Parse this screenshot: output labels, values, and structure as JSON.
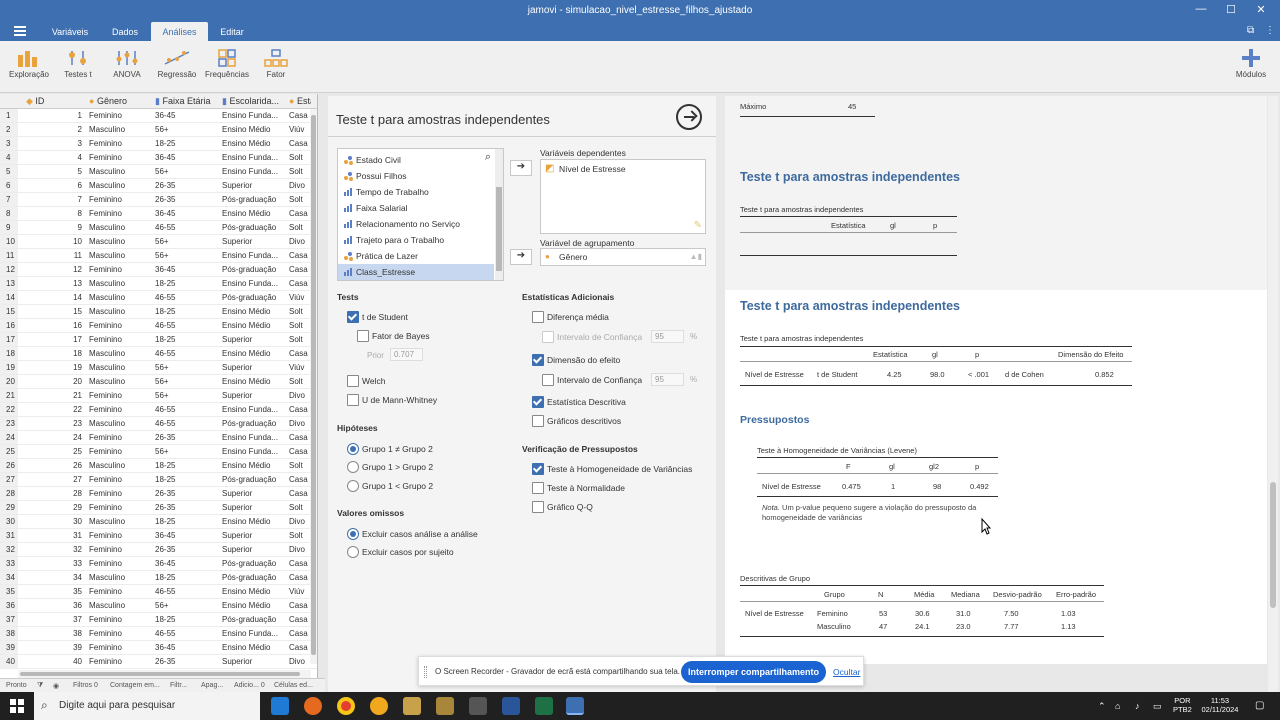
{
  "window": {
    "title": "jamovi - simulacao_nivel_estresse_filhos_ajustado",
    "minimize": "—",
    "maximize": "☐",
    "close": "✕"
  },
  "menu": {
    "tabs": [
      "Variáveis",
      "Dados",
      "Análises",
      "Editar"
    ],
    "active": "Análises"
  },
  "ribbon": {
    "items": [
      "Exploração",
      "Testes t",
      "ANOVA",
      "Regressão",
      "Frequências",
      "Fator"
    ],
    "modules": "Módulos"
  },
  "sheet": {
    "headers": [
      "ID",
      "Gênero",
      "Faixa Etária",
      "Escolarida...",
      "Esta"
    ],
    "rows": [
      [
        "1",
        "Feminino",
        "36-45",
        "Ensino Funda...",
        "Casa"
      ],
      [
        "2",
        "Masculino",
        "56+",
        "Ensino Médio",
        "Viúv"
      ],
      [
        "3",
        "Feminino",
        "18-25",
        "Ensino Médio",
        "Casa"
      ],
      [
        "4",
        "Feminino",
        "36-45",
        "Ensino Funda...",
        "Solt"
      ],
      [
        "5",
        "Masculino",
        "56+",
        "Ensino Funda...",
        "Solt"
      ],
      [
        "6",
        "Masculino",
        "26-35",
        "Superior",
        "Divo"
      ],
      [
        "7",
        "Feminino",
        "26-35",
        "Pós-graduação",
        "Solt"
      ],
      [
        "8",
        "Feminino",
        "36-45",
        "Ensino Médio",
        "Casa"
      ],
      [
        "9",
        "Masculino",
        "46-55",
        "Pós-graduação",
        "Solt"
      ],
      [
        "10",
        "Masculino",
        "56+",
        "Superior",
        "Divo"
      ],
      [
        "11",
        "Masculino",
        "56+",
        "Ensino Funda...",
        "Casa"
      ],
      [
        "12",
        "Feminino",
        "36-45",
        "Pós-graduação",
        "Casa"
      ],
      [
        "13",
        "Masculino",
        "18-25",
        "Ensino Funda...",
        "Casa"
      ],
      [
        "14",
        "Masculino",
        "46-55",
        "Pós-graduação",
        "Viúv"
      ],
      [
        "15",
        "Masculino",
        "18-25",
        "Ensino Médio",
        "Solt"
      ],
      [
        "16",
        "Feminino",
        "46-55",
        "Ensino Médio",
        "Solt"
      ],
      [
        "17",
        "Feminino",
        "18-25",
        "Superior",
        "Solt"
      ],
      [
        "18",
        "Masculino",
        "46-55",
        "Ensino Médio",
        "Casa"
      ],
      [
        "19",
        "Masculino",
        "56+",
        "Superior",
        "Viúv"
      ],
      [
        "20",
        "Masculino",
        "56+",
        "Ensino Médio",
        "Solt"
      ],
      [
        "21",
        "Feminino",
        "56+",
        "Superior",
        "Divo"
      ],
      [
        "22",
        "Feminino",
        "46-55",
        "Ensino Funda...",
        "Casa"
      ],
      [
        "23",
        "Masculino",
        "46-55",
        "Pós-graduação",
        "Divo"
      ],
      [
        "24",
        "Feminino",
        "26-35",
        "Ensino Funda...",
        "Casa"
      ],
      [
        "25",
        "Feminino",
        "56+",
        "Ensino Funda...",
        "Casa"
      ],
      [
        "26",
        "Masculino",
        "18-25",
        "Ensino Médio",
        "Solt"
      ],
      [
        "27",
        "Feminino",
        "18-25",
        "Pós-graduação",
        "Casa"
      ],
      [
        "28",
        "Feminino",
        "26-35",
        "Superior",
        "Casa"
      ],
      [
        "29",
        "Feminino",
        "26-35",
        "Superior",
        "Solt"
      ],
      [
        "30",
        "Masculino",
        "18-25",
        "Ensino Médio",
        "Divo"
      ],
      [
        "31",
        "Feminino",
        "36-45",
        "Superior",
        "Solt"
      ],
      [
        "32",
        "Feminino",
        "26-35",
        "Superior",
        "Divo"
      ],
      [
        "33",
        "Feminino",
        "36-45",
        "Pós-graduação",
        "Casa"
      ],
      [
        "34",
        "Masculino",
        "18-25",
        "Pós-graduação",
        "Casa"
      ],
      [
        "35",
        "Feminino",
        "46-55",
        "Ensino Médio",
        "Viúv"
      ],
      [
        "36",
        "Masculino",
        "56+",
        "Ensino Médio",
        "Casa"
      ],
      [
        "37",
        "Feminino",
        "18-25",
        "Pós-graduação",
        "Casa"
      ],
      [
        "38",
        "Feminino",
        "46-55",
        "Ensino Funda...",
        "Casa"
      ],
      [
        "39",
        "Feminino",
        "36-45",
        "Ensino Médio",
        "Casa"
      ],
      [
        "40",
        "Feminino",
        "26-35",
        "Superior",
        "Divo"
      ]
    ]
  },
  "status": {
    "ready": "Pronto",
    "filters": "Filtros 0",
    "count": "Contagem em...",
    "filt": "Filtr...",
    "apag": "Apag...",
    "adic": "Adicio... 0",
    "cells": "Células ed..."
  },
  "options": {
    "title": "Teste t para amostras independentes",
    "variables": [
      {
        "name": "Estado Civil",
        "type": "nominal"
      },
      {
        "name": "Possui Filhos",
        "type": "nominal"
      },
      {
        "name": "Tempo de Trabalho",
        "type": "ordinal"
      },
      {
        "name": "Faixa Salarial",
        "type": "ordinal"
      },
      {
        "name": "Relacionamento no Serviço",
        "type": "ordinal"
      },
      {
        "name": "Trajeto para o Trabalho",
        "type": "ordinal"
      },
      {
        "name": "Prática de Lazer",
        "type": "nominal"
      },
      {
        "name": "Class_Estresse",
        "type": "ordinal"
      }
    ],
    "arrow": "➔",
    "dependent_label": "Variáveis dependentes",
    "dependent_value": "Nível de Estresse",
    "group_label": "Variável de agrupamento",
    "group_value": "Gênero",
    "tests_label": "Tests",
    "student": "t de Student",
    "bayes": "Fator de Bayes",
    "prior_label": "Prior",
    "prior_value": "0.707",
    "welch": "Welch",
    "mann": "U de Mann-Whitney",
    "hyp_label": "Hipóteses",
    "hyp1": "Grupo 1 ≠ Grupo 2",
    "hyp2": "Grupo 1 > Grupo 2",
    "hyp3": "Grupo 1 < Grupo 2",
    "missing_label": "Valores omissos",
    "missing1": "Excluir casos análise a análise",
    "missing2": "Excluir casos por sujeito",
    "add_label": "Estatísticas Adicionais",
    "mean_diff": "Diferença média",
    "ci": "Intervalo de Confiança",
    "ci_value": "95",
    "pct": "%",
    "effect": "Dimensão do efeito",
    "desc": "Estatística Descritiva",
    "desc_plots": "Gráficos descritivos",
    "assump_label": "Verificação de Pressupostos",
    "homog": "Teste à Homogeneidade de Variâncias",
    "normal": "Teste à Normalidade",
    "qq": "Gráfico Q-Q"
  },
  "results": {
    "prev_label": "Máximo",
    "prev_value": "45",
    "h1_prev": "Teste t para amostras independentes",
    "cap_prev": "Teste t para amostras independentes",
    "prev_cols": [
      "Estatística",
      "gl",
      "p"
    ],
    "h1": "Teste t para amostras independentes",
    "cap": "Teste t para amostras independentes",
    "ttest_cols": [
      "Estatística",
      "gl",
      "p",
      "Dimensão do Efeito"
    ],
    "ttest_row": [
      "Nível de Estresse",
      "t de Student",
      "4.25",
      "98.0",
      "< .001",
      "d de Cohen",
      "0.852"
    ],
    "h2": "Pressupostos",
    "lev_cap": "Teste à Homogeneidade de Variâncias (Levene)",
    "lev_cols": [
      "F",
      "gl",
      "gl2",
      "p"
    ],
    "lev_row": [
      "Nível de Estresse",
      "0.475",
      "1",
      "98",
      "0.492"
    ],
    "note_label": "Nota.",
    "note": "Um p-value pequeno sugere a violação do pressuposto da homogeneidade de variâncias",
    "desc_cap": "Descritivas de Grupo",
    "desc_cols": [
      "Grupo",
      "N",
      "Média",
      "Mediana",
      "Desvio-padrão",
      "Erro-padrão"
    ],
    "desc_var": "Nível de Estresse",
    "desc_rows": [
      [
        "Feminino",
        "53",
        "30.6",
        "31.0",
        "7.50",
        "1.03"
      ],
      [
        "Masculino",
        "47",
        "24.1",
        "23.0",
        "7.77",
        "1.13"
      ]
    ]
  },
  "recorder": {
    "message": "O Screen Recorder - Gravador de ecrã está compartilhando sua tela.",
    "stop": "Interromper compartilhamento",
    "hide": "Ocultar"
  },
  "taskbar": {
    "search": "Digite aqui para pesquisar",
    "lang1": "POR",
    "lang2": "PTB2",
    "time": "11:53",
    "date": "02/11/2024"
  },
  "colors": {
    "brand": "#3e6fb0",
    "heading": "#3e6a9e",
    "accent_button": "#1a63d0"
  }
}
